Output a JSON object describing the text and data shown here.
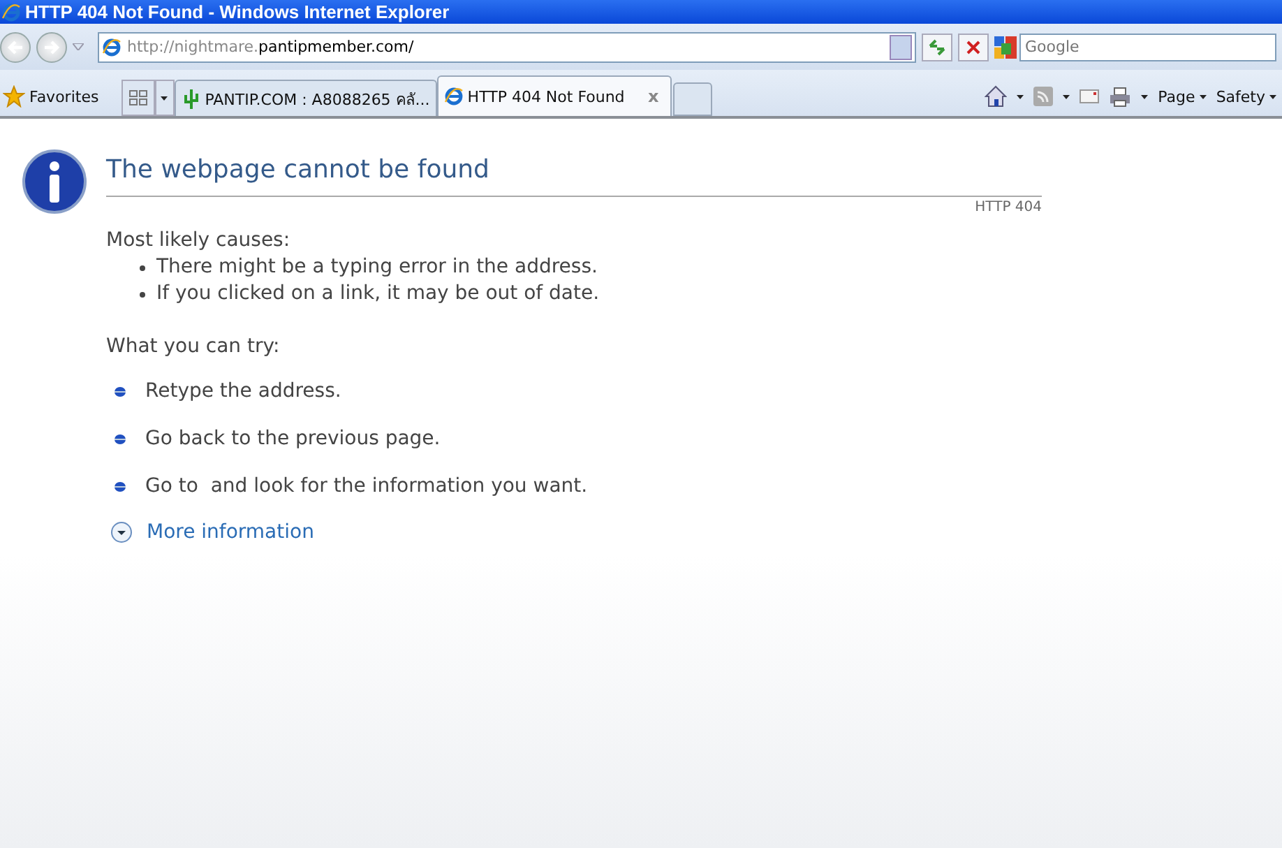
{
  "window": {
    "title": "HTTP 404 Not Found - Windows Internet Explorer"
  },
  "address": {
    "muted": "http://nightmare.",
    "domain": "pantipmember.com/"
  },
  "search": {
    "placeholder": "Google"
  },
  "favorites": {
    "label": "Favorites"
  },
  "tabs": [
    {
      "label": "PANTIP.COM : A8088265 คลั...",
      "kind": "cactus",
      "selected": false
    },
    {
      "label": "HTTP 404 Not Found",
      "kind": "ie",
      "selected": true,
      "close": "x"
    }
  ],
  "command_bar": [
    "Page",
    "Safety"
  ],
  "page": {
    "heading": "The webpage cannot be found",
    "code": "HTTP 404",
    "causes_title": "Most likely causes:",
    "causes": [
      "There might be a typing error in the address.",
      "If you clicked on a link, it may be out of date."
    ],
    "try_title": "What you can try:",
    "tries": [
      "Retype the address.",
      "Go back to the previous page.",
      "Go to  and look for the information you want."
    ],
    "more": "More information"
  }
}
